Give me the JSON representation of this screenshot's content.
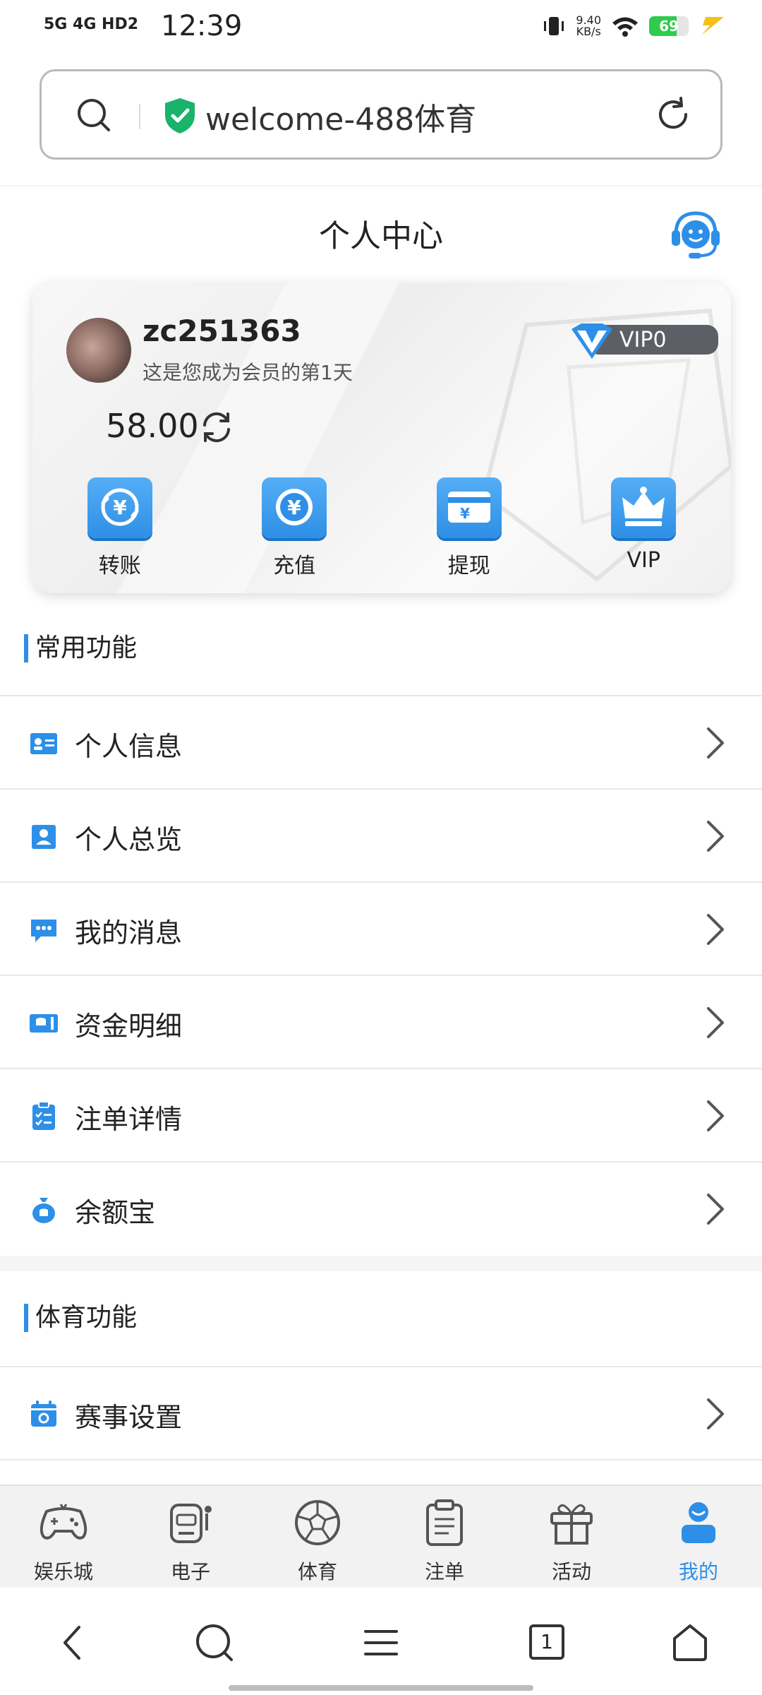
{
  "status_bar": {
    "network": "5G 4G HD2",
    "time": "12:39",
    "net_speed_value": "9.40",
    "net_speed_unit": "KB/s",
    "battery_level": "69",
    "battery_fraction": 0.69,
    "battery_color": "#2fcb4d"
  },
  "browser": {
    "url": "welcome-488体育",
    "secure_icon": "shield-check-icon"
  },
  "header": {
    "title": "个人中心",
    "service_icon": "customer-service-icon"
  },
  "profile": {
    "username": "zc251363",
    "member_days": "这是您成为会员的第1天",
    "vip_level": "VIP0",
    "balance": "58.00"
  },
  "quick_actions": [
    {
      "label": "转账",
      "icon": "transfer-icon"
    },
    {
      "label": "充值",
      "icon": "deposit-icon"
    },
    {
      "label": "提现",
      "icon": "withdraw-icon"
    },
    {
      "label": "VIP",
      "icon": "crown-icon"
    }
  ],
  "common_section": {
    "title": "常用功能",
    "items": [
      {
        "label": "个人信息",
        "icon": "id-card-icon"
      },
      {
        "label": "个人总览",
        "icon": "profile-overview-icon"
      },
      {
        "label": "我的消息",
        "icon": "message-icon"
      },
      {
        "label": "资金明细",
        "icon": "funds-icon"
      },
      {
        "label": "注单详情",
        "icon": "bet-list-icon"
      },
      {
        "label": "余额宝",
        "icon": "money-bag-icon"
      }
    ]
  },
  "sports_section": {
    "title": "体育功能",
    "items": [
      {
        "label": "赛事设置",
        "icon": "calendar-settings-icon"
      }
    ]
  },
  "tabbar": {
    "active_color": "#2d8fe8",
    "items": [
      {
        "label": "娱乐城",
        "icon": "gamepad-icon"
      },
      {
        "label": "电子",
        "icon": "slot-machine-icon"
      },
      {
        "label": "体育",
        "icon": "soccer-ball-icon"
      },
      {
        "label": "注单",
        "icon": "clipboard-icon"
      },
      {
        "label": "活动",
        "icon": "gift-icon"
      },
      {
        "label": "我的",
        "icon": "user-icon"
      }
    ]
  },
  "browser_nav": {
    "tab_count": "1"
  },
  "accent_color": "#2d8fe8"
}
